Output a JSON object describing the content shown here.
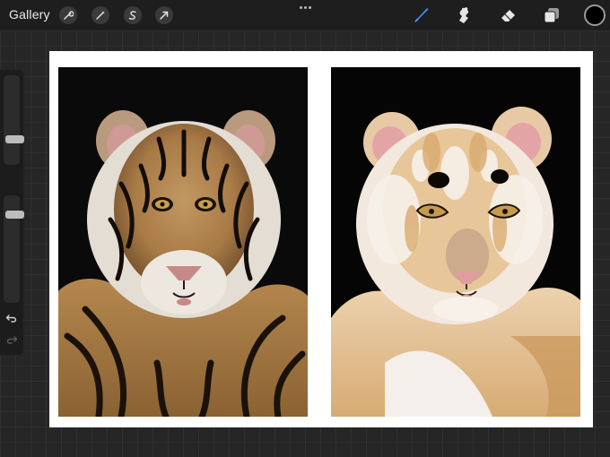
{
  "topbar": {
    "gallery_label": "Gallery",
    "left_tools": [
      "wrench-icon",
      "magic-wand-icon",
      "selection-s-icon",
      "transform-arrow-icon"
    ],
    "right_tools": [
      "brush-icon",
      "smudge-icon",
      "eraser-icon",
      "layers-icon"
    ],
    "active_tool": "brush-icon",
    "active_color": "#000000",
    "accent_color": "#3d8bff"
  },
  "sidebar": {
    "brush_size_level": 0.5,
    "opacity_level": 0.35
  },
  "canvas": {
    "background": "#ffffff",
    "panels": [
      "tiger-photo",
      "tiger-painting"
    ]
  }
}
